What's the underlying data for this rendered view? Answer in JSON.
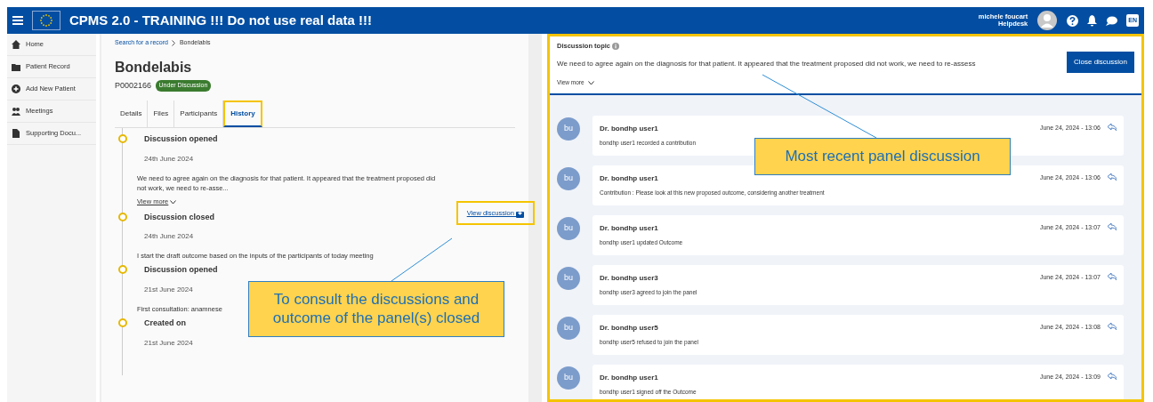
{
  "topbar": {
    "title": "CPMS 2.0 - TRAINING !!! Do not use real data !!!",
    "user_name": "michele foucart",
    "user_role": "Helpdesk",
    "language": "EN"
  },
  "sidebar": {
    "items": [
      {
        "label": "Home"
      },
      {
        "label": "Patient Record"
      },
      {
        "label": "Add New Patient"
      },
      {
        "label": "Meetings"
      },
      {
        "label": "Supporting Docu..."
      }
    ]
  },
  "breadcrumb": [
    "Search for a record",
    "Bondelabis"
  ],
  "patient": {
    "name": "Bondelabis",
    "id": "P0002166",
    "status": "Under Discussion"
  },
  "tabs": [
    {
      "label": "Details",
      "selected": false
    },
    {
      "label": "Files",
      "selected": false
    },
    {
      "label": "Participants",
      "selected": false
    },
    {
      "label": "History",
      "selected": true
    }
  ],
  "history": [
    {
      "title": "Discussion opened",
      "date": "24th June 2024",
      "text": "We need to agree again on the diagnosis for that patient. It appeared that the treatment proposed did not work, we need to re-asse...",
      "view_more": "View more"
    },
    {
      "title": "Discussion closed",
      "date": "24th June 2024",
      "text": "I start the draft outcome based on the inputs of the participants of today meeting",
      "link": "View discussion"
    },
    {
      "title": "Discussion opened",
      "date": "21st June 2024",
      "text": "First consultation: anamnese"
    },
    {
      "title": "Created on",
      "date": "21st June 2024"
    }
  ],
  "discussion": {
    "topic_label": "Discussion topic",
    "topic_text": "We need to agree again on the diagnosis for that patient. It appeared that the treatment proposed did not work, we need to re-assess",
    "view_more": "View more",
    "close_button": "Close discussion"
  },
  "messages": [
    {
      "avatar": "bu",
      "author": "Dr. bondhp user1",
      "time": "June 24, 2024 - 13:06",
      "text": "bondhp user1 recorded a contribution"
    },
    {
      "avatar": "bu",
      "author": "Dr. bondhp user1",
      "time": "June 24, 2024 - 13:06",
      "text": "Contribution : Please look at this new proposed outcome, considering another treatment"
    },
    {
      "avatar": "bu",
      "author": "Dr. bondhp user1",
      "time": "June 24, 2024 - 13:07",
      "text": "bondhp user1 updated Outcome"
    },
    {
      "avatar": "bu",
      "author": "Dr. bondhp user3",
      "time": "June 24, 2024 - 13:07",
      "text": "bondhp user3 agreed to join the panel"
    },
    {
      "avatar": "bu",
      "author": "Dr. bondhp user5",
      "time": "June 24, 2024 - 13:08",
      "text": "bondhp user5 refused to join the panel"
    },
    {
      "avatar": "bu",
      "author": "Dr. bondhp user1",
      "time": "June 24, 2024 - 13:09",
      "text": "bondhp user1 signed off the Outcome"
    }
  ],
  "callouts": [
    "To consult the discussions and outcome of the panel(s) closed",
    "Most recent panel discussion"
  ]
}
